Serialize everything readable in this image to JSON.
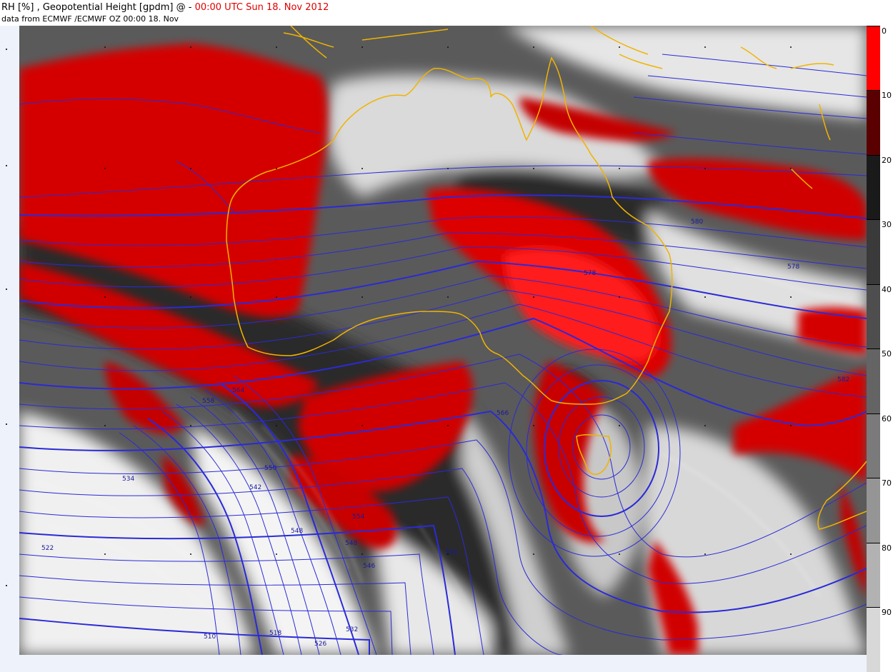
{
  "header": {
    "title_prefix": "RH [%] , Geopotential Height [gpdm] @ - ",
    "title_time": "00:00 UTC Sun 18. Nov 2012",
    "subtitle": "data from ECMWF /ECMWF OZ 00:00 18. Nov"
  },
  "colorbar": {
    "labels": [
      "0",
      "10",
      "20",
      "30",
      "40",
      "50",
      "60",
      "70",
      "80",
      "90"
    ],
    "colors": [
      "#ff0000",
      "#5a0000",
      "#1a1a1a",
      "#3a3a3a",
      "#4e4e4e",
      "#646464",
      "#7a7a7a",
      "#959595",
      "#b2b2b2",
      "#d4d4d4",
      "#ececec"
    ]
  },
  "contour_labels": [
    "580",
    "578",
    "582",
    "564",
    "566",
    "558",
    "550",
    "542",
    "548",
    "534",
    "554",
    "556",
    "546",
    "522",
    "510",
    "518",
    "526",
    "532"
  ],
  "colors": {
    "moist_high": "#ff0000",
    "dry": "#c40000",
    "coastline": "#f0b400",
    "contour": "#2a2ad8"
  }
}
